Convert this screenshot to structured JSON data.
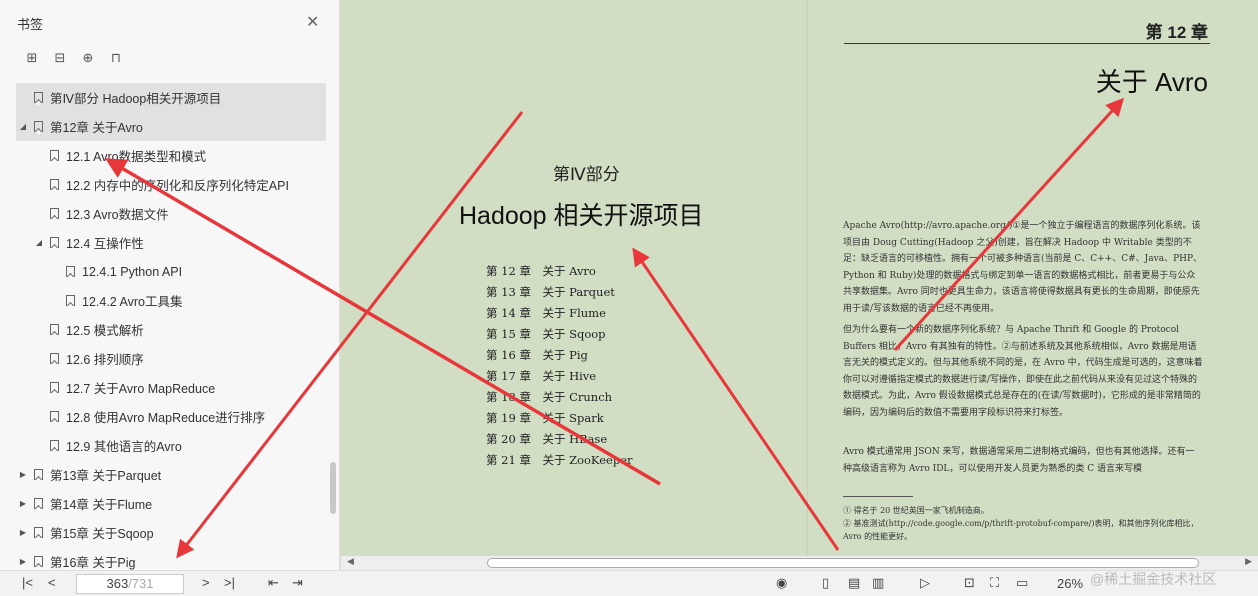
{
  "sidebar": {
    "title": "书签",
    "tools": [
      "expand-icon",
      "collapse-icon",
      "add-bookmark-icon",
      "bookmark-icon"
    ],
    "items": [
      {
        "label": "第Ⅳ部分 Hadoop相关开源项目",
        "level": 0,
        "tri": "",
        "sel": true
      },
      {
        "label": "第12章 关于Avro",
        "level": 0,
        "tri": "◢",
        "sel": true
      },
      {
        "label": "12.1 Avro数据类型和模式",
        "level": 1,
        "tri": "",
        "sel": false
      },
      {
        "label": "12.2 内存中的序列化和反序列化特定API",
        "level": 1,
        "tri": "",
        "sel": false
      },
      {
        "label": "12.3 Avro数据文件",
        "level": 1,
        "tri": "",
        "sel": false
      },
      {
        "label": "12.4 互操作性",
        "level": 1,
        "tri": "◢",
        "sel": false
      },
      {
        "label": "12.4.1 Python API",
        "level": 2,
        "tri": "",
        "sel": false
      },
      {
        "label": "12.4.2 Avro工具集",
        "level": 2,
        "tri": "",
        "sel": false
      },
      {
        "label": "12.5 模式解析",
        "level": 1,
        "tri": "",
        "sel": false
      },
      {
        "label": "12.6 排列顺序",
        "level": 1,
        "tri": "",
        "sel": false
      },
      {
        "label": "12.7 关于Avro MapReduce",
        "level": 1,
        "tri": "",
        "sel": false
      },
      {
        "label": "12.8 使用Avro MapReduce进行排序",
        "level": 1,
        "tri": "",
        "sel": false
      },
      {
        "label": "12.9 其他语言的Avro",
        "level": 1,
        "tri": "",
        "sel": false
      },
      {
        "label": "第13章 关于Parquet",
        "level": 0,
        "tri": "▶",
        "sel": false
      },
      {
        "label": "第14章 关于Flume",
        "level": 0,
        "tri": "▶",
        "sel": false
      },
      {
        "label": "第15章 关于Sqoop",
        "level": 0,
        "tri": "▶",
        "sel": false
      },
      {
        "label": "第16章 关于Pig",
        "level": 0,
        "tri": "▶",
        "sel": false
      }
    ]
  },
  "left_page": {
    "part_label": "第Ⅳ部分",
    "part_title": "Hadoop 相关开源项目",
    "toc": [
      "第 12 章　关于 Avro",
      "第 13 章　关于 Parquet",
      "第 14 章　关于 Flume",
      "第 15 章　关于 Sqoop",
      "第 16 章　关于 Pig",
      "第 17 章　关于 Hive",
      "第 18 章　关于 Crunch",
      "第 19 章　关于 Spark",
      "第 20 章　关于 HBase",
      "第 21 章　关于 ZooKeeper"
    ]
  },
  "right_page": {
    "chapter_no": "第 12 章",
    "chapter_title": "关于 Avro",
    "para1": "Apache Avro(http://avro.apache.org/)①是一个独立于编程语言的数据序列化系统。该项目由 Doug Cutting(Hadoop 之父)创建，旨在解决 Hadoop 中 Writable 类型的不足：缺乏语言的可移植性。拥有一个可被多种语言(当前是 C、C++、C#、Java、PHP、Python 和 Ruby)处理的数据格式与绑定到单一语言的数据格式相比，前者更易于与公众共享数据集。Avro 同时也更具生命力，该语言将使得数据具有更长的生命周期，即使原先用于读/写该数据的语言已经不再使用。",
    "para2": "但为什么要有一个新的数据序列化系统？与 Apache Thrift 和 Google 的 Protocol Buffers 相比，Avro 有其独有的特性。②与前述系统及其他系统相似，Avro 数据是用语言无关的模式定义的。但与其他系统不同的是，在 Avro 中，代码生成是可选的，这意味着你可以对遵循指定模式的数据进行读/写操作，即使在此之前代码从来没有见过这个特殊的数据模式。为此，Avro 假设数据模式总是存在的(在读/写数据时)，它形成的是非常精简的编码，因为编码后的数值不需要用字段标识符来打标签。",
    "para3": "Avro 模式通常用 JSON 来写，数据通常采用二进制格式编码，但也有其他选择。还有一种高级语言称为 Avro IDL，可以使用开发人员更为熟悉的类 C 语言来写模",
    "footnote1": "① 得名于 20 世纪英国一家飞机制造商。",
    "footnote2": "② 基准测试(http://code.google.com/p/thrift-protobuf-compare/)表明，和其他序列化库相比，Avro 的性能更好。"
  },
  "statusbar": {
    "page_current": "363",
    "page_total": "/731",
    "zoom": "26%"
  },
  "watermark": "@稀土掘金技术社区",
  "accent_arrow_color": "#e8373a"
}
